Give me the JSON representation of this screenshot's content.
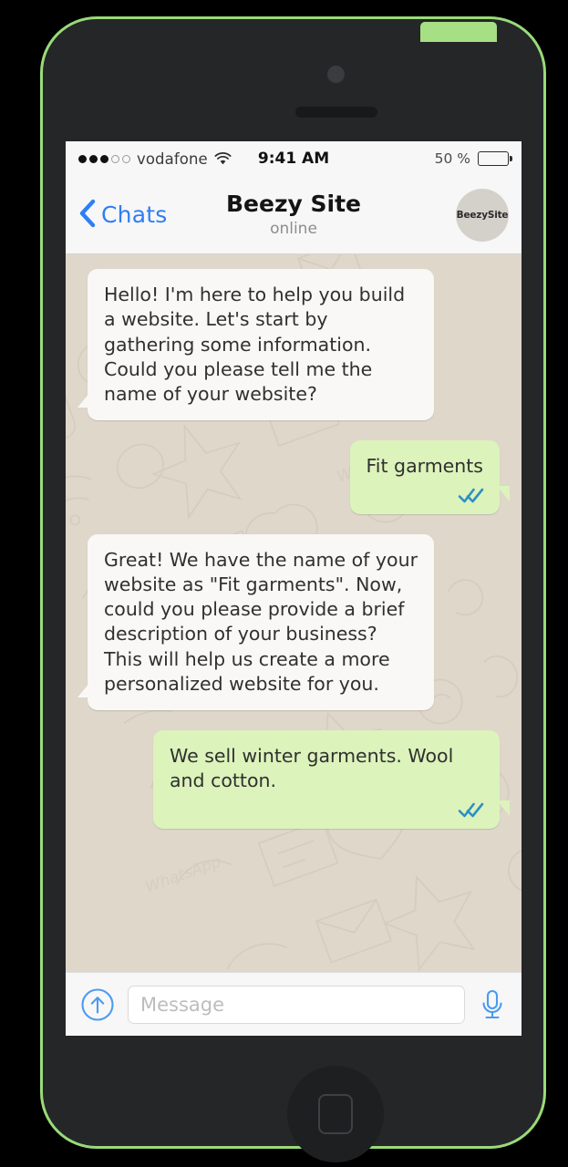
{
  "device": {
    "frame_color": "#9ada78",
    "body_color": "#242628",
    "buttons": {
      "silent_switch": "silent-switch",
      "volume_up": "volume-up-button",
      "volume_down": "volume-down-button",
      "power": "power-button",
      "home": "home-button"
    }
  },
  "status_bar": {
    "signal_dots_filled": 3,
    "signal_dots_total": 5,
    "carrier": "vodafone",
    "wifi_icon": "wifi-icon",
    "time": "9:41 AM",
    "battery_percent_label": "50 %",
    "battery_level": 50
  },
  "header": {
    "back_label": "Chats",
    "back_icon": "chevron-left-icon",
    "title": "Beezy Site",
    "subtitle": "online",
    "avatar_label": "BeezySite",
    "accent_color": "#2f7ef5"
  },
  "conversation": {
    "messages": [
      {
        "direction": "incoming",
        "text": "Hello! I'm here to help you build a website. Let's start by gathering some information. Could you please tell me the name of your website?",
        "ticks": false
      },
      {
        "direction": "outgoing",
        "text": "Fit garments",
        "ticks": true,
        "tick_icon": "double-check-icon"
      },
      {
        "direction": "incoming",
        "text": "Great! We have the name of your website as \"Fit garments\". Now, could you please provide a brief description of your business? This will help us create a more personalized website for you.",
        "ticks": false
      },
      {
        "direction": "outgoing",
        "text": "We sell winter garments. Wool and cotton.",
        "ticks": true,
        "tick_icon": "double-check-icon"
      }
    ],
    "incoming_bubble_color": "#f9f8f6",
    "outgoing_bubble_color": "#dcf3bb",
    "tick_color": "#2e8fc4",
    "wallpaper_text": "WhatsApp"
  },
  "input_bar": {
    "attach_icon": "arrow-up-circle-icon",
    "placeholder": "Message",
    "value": "",
    "mic_icon": "microphone-icon",
    "icon_color": "#4a9bf0"
  }
}
